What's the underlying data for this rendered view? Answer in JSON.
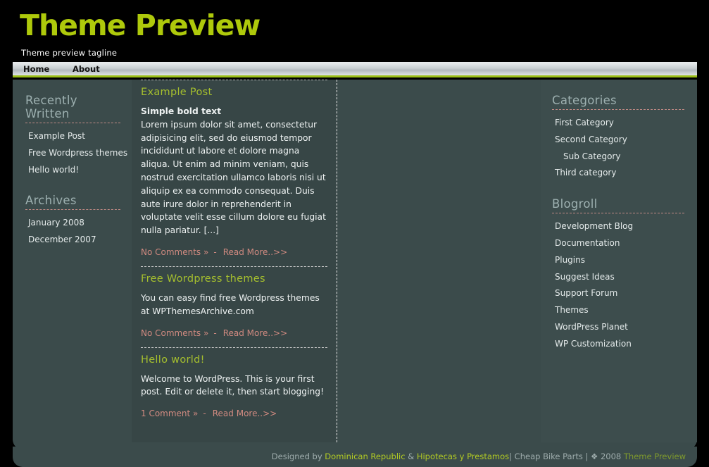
{
  "header": {
    "title": "Theme Preview",
    "tagline": "Theme preview tagline"
  },
  "nav": {
    "items": [
      {
        "label": "Home"
      },
      {
        "label": "About"
      }
    ]
  },
  "sidebar_left": {
    "widgets": [
      {
        "title": "Recently Written",
        "items": [
          {
            "label": "Example Post"
          },
          {
            "label": "Free Wordpress themes"
          },
          {
            "label": "Hello world!"
          }
        ]
      },
      {
        "title": "Archives",
        "items": [
          {
            "label": "January 2008"
          },
          {
            "label": "December 2007"
          }
        ]
      }
    ]
  },
  "sidebar_right": {
    "widgets": [
      {
        "title": "Categories",
        "items": [
          {
            "label": "First Category",
            "indent": false
          },
          {
            "label": "Second Category",
            "indent": false
          },
          {
            "label": "Sub Category",
            "indent": true
          },
          {
            "label": "Third category",
            "indent": false
          }
        ]
      },
      {
        "title": "Blogroll",
        "items": [
          {
            "label": "Development Blog",
            "indent": false
          },
          {
            "label": "Documentation",
            "indent": false
          },
          {
            "label": "Plugins",
            "indent": false
          },
          {
            "label": "Suggest Ideas",
            "indent": false
          },
          {
            "label": "Support Forum",
            "indent": false
          },
          {
            "label": "Themes",
            "indent": false
          },
          {
            "label": "WordPress Planet",
            "indent": false
          },
          {
            "label": "WP Customization",
            "indent": false
          }
        ]
      }
    ]
  },
  "posts": [
    {
      "title": "Example Post",
      "lead": "Simple bold text",
      "body": "Lorem ipsum dolor sit amet, consectetur adipisicing elit, sed do eiusmod tempor incididunt ut labore et dolore magna aliqua. Ut enim ad minim veniam, quis nostrud exercitation ullamco laboris nisi ut aliquip ex ea commodo consequat. Duis aute irure dolor in reprehenderit in voluptate velit esse cillum dolore eu fugiat nulla pariatur. [...]",
      "comments_label": "No Comments »",
      "separator": "-",
      "read_more_label": "Read More..>>"
    },
    {
      "title": "Free Wordpress themes",
      "lead": "",
      "body": "You can easy find free Wordpress themes at WPThemesArchive.com",
      "comments_label": "No Comments »",
      "separator": "-",
      "read_more_label": "Read More..>>"
    },
    {
      "title": "Hello world!",
      "lead": "",
      "body": "Welcome to WordPress. This is your first post. Edit or delete it, then start blogging!",
      "comments_label": "1 Comment »",
      "separator": "-",
      "read_more_label": "Read More..>>"
    }
  ],
  "footer": {
    "designed_by": "Designed by ",
    "link1": "Dominican Republic",
    "amp": " & ",
    "link2": "Hipotecas y Prestamos",
    "pipe1": "| ",
    "link3": "Cheap Bike Parts",
    "pipe2": " | ",
    "copyright_symbol": "❖",
    "year": " 2008 ",
    "site": "Theme Preview"
  },
  "colors": {
    "accent_green": "#aec90b",
    "nav_underline_green": "#9bbf16",
    "page_bg": "#000000",
    "container_bg": "#3b4b4b",
    "content_bg": "#374646",
    "sidebar_right_bg": "#3d4d4d",
    "post_title": "#a5bf2e",
    "widget_title": "#9db0b0",
    "meta_link": "#d08a80",
    "dashed_rule": "#c08a84",
    "body_text": "#eef2f2"
  }
}
